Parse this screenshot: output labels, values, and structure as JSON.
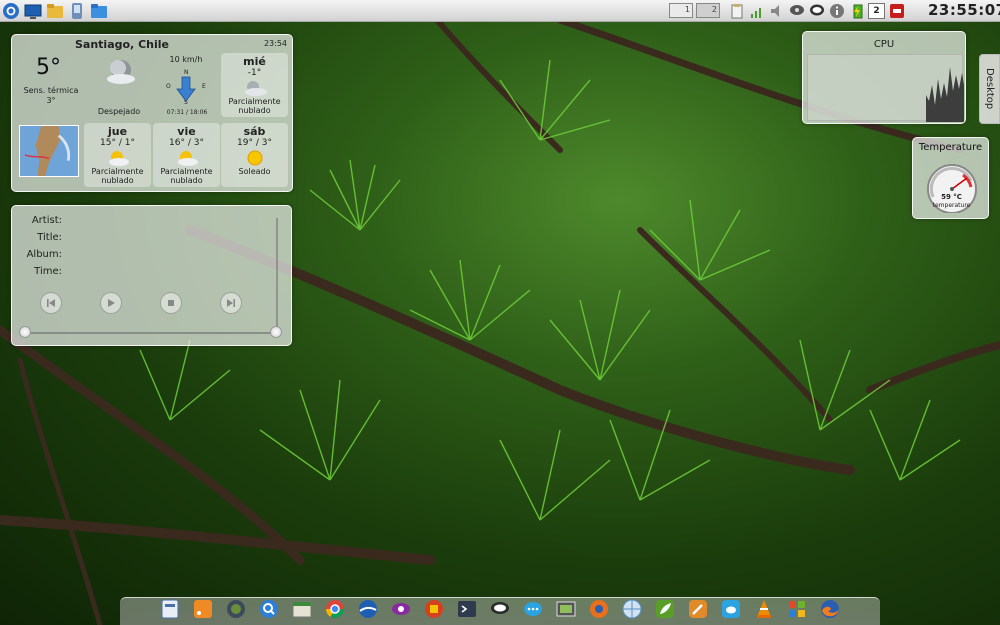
{
  "top_panel": {
    "launchers": [
      {
        "name": "kde-menu-icon"
      },
      {
        "name": "desktop-icon"
      },
      {
        "name": "file-manager-icon"
      },
      {
        "name": "device-icon"
      },
      {
        "name": "folder-icon"
      }
    ],
    "pager": {
      "desktops": [
        "1",
        "2"
      ],
      "active": 2
    },
    "tray": {
      "calendar_day": "2"
    },
    "clock": "23:55:07"
  },
  "weather": {
    "location": "Santiago, Chile",
    "updated_time": "23:54",
    "current_temp": "5°",
    "feels_like_label": "Sens. térmica",
    "feels_like_value": "3°",
    "condition": "Despejado",
    "wind_speed": "10 km/h",
    "compass": {
      "n": "N",
      "s": "S",
      "e": "E",
      "o": "O"
    },
    "sun_times": "07:31 / 18:06",
    "forecast": [
      {
        "day": "mié",
        "temps": "-1°",
        "desc_line1": "Parcialmente",
        "desc_line2": "nublado",
        "icon": "partly-cloudy-night-icon"
      },
      {
        "day": "jue",
        "temps": "15° / 1°",
        "desc_line1": "Parcialmente",
        "desc_line2": "nublado",
        "icon": "partly-cloudy-icon"
      },
      {
        "day": "vie",
        "temps": "16° / 3°",
        "desc_line1": "Parcialmente",
        "desc_line2": "nublado",
        "icon": "partly-cloudy-icon"
      },
      {
        "day": "sáb",
        "temps": "19° / 3°",
        "desc_line1": "Soleado",
        "desc_line2": "",
        "icon": "sun-icon"
      }
    ]
  },
  "player": {
    "labels": {
      "artist": "Artist:",
      "title": "Title:",
      "album": "Album:",
      "time": "Time:"
    },
    "controls": [
      "previous-icon",
      "play-icon",
      "stop-icon",
      "next-icon"
    ]
  },
  "cpu": {
    "title": "CPU"
  },
  "desktop_tab": {
    "label": "Desktop"
  },
  "temperature": {
    "title": "Temperature",
    "value": "59 °C",
    "label": "temperature"
  },
  "dock": {
    "icons": [
      "system-settings-icon",
      "rss-feed-icon",
      "globe-icon",
      "search-icon",
      "archive-icon",
      "chrome-icon",
      "google-earth-icon",
      "eye-icon",
      "app-store-icon",
      "terminal-icon",
      "chat-icon",
      "message-icon",
      "screenshot-icon",
      "media-player-icon",
      "network-icon",
      "leaf-app-icon",
      "tools-icon",
      "twitter-icon",
      "vlc-icon",
      "windows-icon",
      "firefox-icon"
    ]
  }
}
